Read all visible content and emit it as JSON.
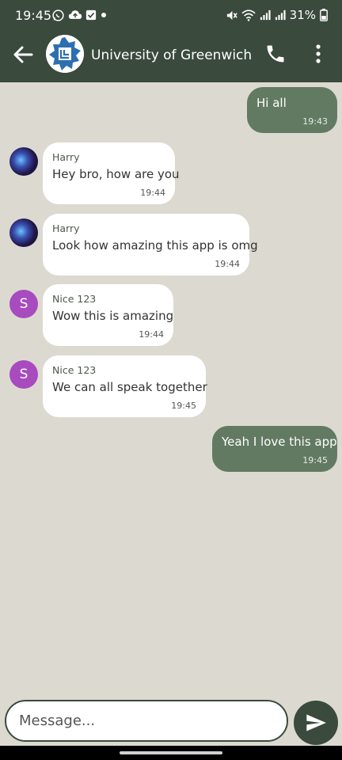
{
  "status_bar": {
    "time": "19:45",
    "battery": "31%",
    "left_icons": [
      "whatsapp-icon",
      "cloud-upload-icon",
      "checkbox-icon",
      "dot-icon"
    ],
    "right_icons": [
      "mute-icon",
      "wifi-icon",
      "signal-icon",
      "signal-icon",
      "battery-icon"
    ]
  },
  "header": {
    "title": "University of Greenwich",
    "icons": {
      "back": "arrow-left-icon",
      "call": "phone-icon",
      "menu": "more-vertical-icon"
    }
  },
  "messages": [
    {
      "direction": "out",
      "text": "Hi all",
      "time": "19:43"
    },
    {
      "direction": "in",
      "sender": "Harry",
      "avatar": "image",
      "text": "Hey bro, how are you",
      "time": "19:44"
    },
    {
      "direction": "in",
      "sender": "Harry",
      "avatar": "image",
      "text": "Look how amazing this app is omg",
      "time": "19:44"
    },
    {
      "direction": "in",
      "sender": "Nice 123",
      "avatar": "S",
      "text": "Wow this is amazing",
      "time": "19:44"
    },
    {
      "direction": "in",
      "sender": "Nice 123",
      "avatar": "S",
      "text": "We can all speak together",
      "time": "19:45"
    },
    {
      "direction": "out",
      "text": "Yeah I love this app",
      "time": "19:45"
    }
  ],
  "compose": {
    "placeholder": "Message...",
    "value": "",
    "send_icon": "send-icon"
  },
  "colors": {
    "header_bg": "#3a4a3d",
    "chat_bg": "#dcdad0",
    "outgoing_bubble": "#627a62",
    "incoming_bubble": "#ffffff",
    "avatar_letter_bg": "#a84bbf"
  }
}
